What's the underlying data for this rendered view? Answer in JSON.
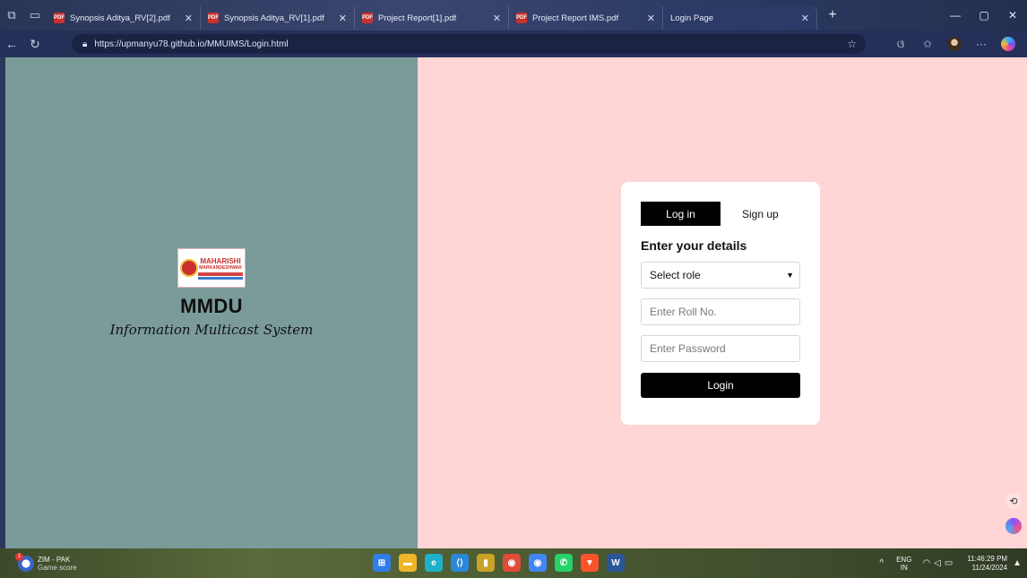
{
  "browser": {
    "tabs": [
      {
        "label": "Synopsis Aditya_RV[2].pdf",
        "icon": "pdf-icon",
        "active": false
      },
      {
        "label": "Synopsis Aditya_RV[1].pdf",
        "icon": "pdf-icon",
        "active": false
      },
      {
        "label": "Project Report[1].pdf",
        "icon": "pdf-icon",
        "active": false
      },
      {
        "label": "Project Report IMS.pdf",
        "icon": "pdf-icon",
        "active": false
      },
      {
        "label": "Login Page",
        "icon": "page-icon",
        "active": true
      }
    ],
    "url": "https://upmanyu78.github.io/MMUIMS/Login.html"
  },
  "brand": {
    "logo_line1": "MAHARISHI",
    "logo_line2": "MARKANDESHWAR",
    "title": "MMDU",
    "subtitle": "Information Multicast System"
  },
  "login_card": {
    "tab_login": "Log in",
    "tab_signup": "Sign up",
    "heading": "Enter your details",
    "role_select": "Select role",
    "roll_placeholder": "Enter Roll No.",
    "password_placeholder": "Enter Password",
    "login_button": "Login"
  },
  "taskbar": {
    "weather_line1": "ZIM - PAK",
    "weather_line2": "Game score",
    "weather_badge": "1",
    "lang_line1": "ENG",
    "lang_line2": "IN",
    "time": "11:46:29 PM",
    "date": "11/24/2024"
  },
  "colors": {
    "left_panel": "#7a9b99",
    "right_panel": "#ffd5d5",
    "button": "#000000",
    "card": "#ffffff"
  }
}
